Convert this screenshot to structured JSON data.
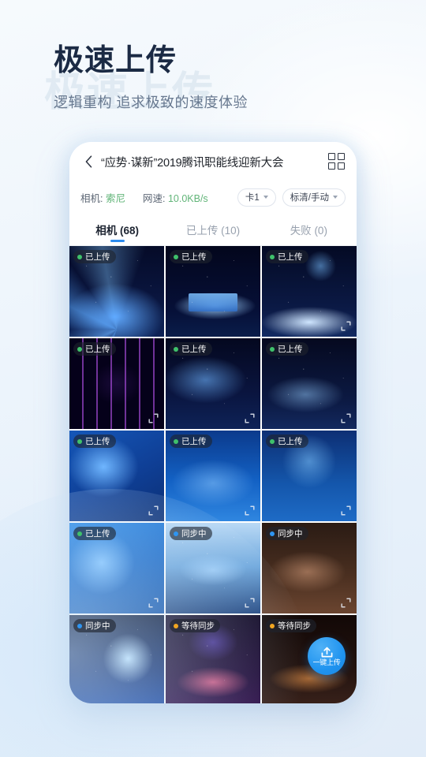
{
  "hero": {
    "watermark": "极速上传",
    "title": "极速上传",
    "subtitle": "逻辑重构 追求极致的速度体验"
  },
  "app": {
    "header": {
      "back_icon": "chevron-left-icon",
      "title": "“应势·谋新”2019腾讯职能线迎新大会",
      "grid_view_icon": "grid-view-icon"
    },
    "status": {
      "camera_label": "相机:",
      "camera_value": "索尼",
      "speed_label": "网速:",
      "speed_value": "10.0KB/s",
      "card_select": "卡1",
      "quality_select": "标清/手动"
    },
    "tabs": [
      {
        "label": "相机 (68)",
        "active": true
      },
      {
        "label": "已上传 (10)",
        "active": false
      },
      {
        "label": "失败 (0)",
        "active": false
      }
    ],
    "fab": {
      "icon": "upload-icon",
      "label": "一键上传"
    },
    "status_colors": {
      "uploaded": "#3fc16b",
      "syncing": "#2e95f2",
      "pending": "#f0a521"
    },
    "photos": [
      {
        "status": "已上传",
        "state": "uploaded",
        "art": "a1",
        "expand": false,
        "sparkle": true
      },
      {
        "status": "已上传",
        "state": "uploaded",
        "art": "a2",
        "expand": false,
        "sparkle": true
      },
      {
        "status": "已上传",
        "state": "uploaded",
        "art": "a3",
        "expand": true,
        "sparkle": true
      },
      {
        "status": "已上传",
        "state": "uploaded",
        "art": "a4",
        "expand": true,
        "sparkle": false
      },
      {
        "status": "已上传",
        "state": "uploaded",
        "art": "a5",
        "expand": true,
        "sparkle": true
      },
      {
        "status": "已上传",
        "state": "uploaded",
        "art": "a6",
        "expand": true,
        "sparkle": true
      },
      {
        "status": "已上传",
        "state": "uploaded",
        "art": "a7",
        "expand": true,
        "sparkle": false
      },
      {
        "status": "已上传",
        "state": "uploaded",
        "art": "a8",
        "expand": true,
        "sparkle": false
      },
      {
        "status": "已上传",
        "state": "uploaded",
        "art": "a9",
        "expand": true,
        "sparkle": false
      },
      {
        "status": "已上传",
        "state": "uploaded",
        "art": "a10",
        "expand": true,
        "sparkle": false
      },
      {
        "status": "同步中",
        "state": "syncing",
        "art": "a11",
        "expand": true,
        "sparkle": true
      },
      {
        "status": "同步中",
        "state": "syncing",
        "art": "a12",
        "expand": true,
        "sparkle": false
      },
      {
        "status": "同步中",
        "state": "syncing",
        "art": "a13",
        "expand": false,
        "sparkle": true
      },
      {
        "status": "等待同步",
        "state": "pending",
        "art": "a14",
        "expand": false,
        "sparkle": true
      },
      {
        "status": "等待同步",
        "state": "pending",
        "art": "a15",
        "expand": false,
        "sparkle": false
      }
    ]
  }
}
